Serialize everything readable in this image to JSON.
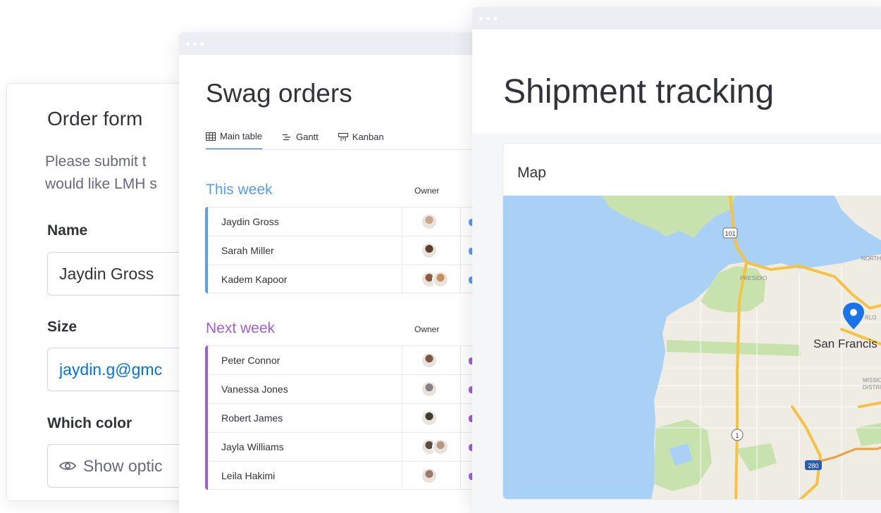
{
  "order_form": {
    "title": "Order form",
    "description": "Please submit t\nwould like LMH s",
    "name_label": "Name",
    "name_value": "Jaydin Gross",
    "size_label": "Size",
    "size_value": "jaydin.g@gmc",
    "color_label": "Which color",
    "color_button": "Show optic",
    "icons": {
      "show_options": "eye-icon"
    }
  },
  "swag": {
    "title": "Swag orders",
    "tabs": [
      {
        "label": "Main table",
        "icon": "table-icon",
        "active": true
      },
      {
        "label": "Gantt",
        "icon": "gantt-icon",
        "active": false
      },
      {
        "label": "Kanban",
        "icon": "kanban-icon",
        "active": false
      }
    ],
    "groups": [
      {
        "title": "This week",
        "owner_header": "Owner",
        "color": "#579bfc",
        "rows": [
          {
            "name": "Jaydin Gross",
            "avatars": [
              "#c9a88a"
            ]
          },
          {
            "name": "Sarah Miller",
            "avatars": [
              "#5a3e2b"
            ]
          },
          {
            "name": "Kadem Kapoor",
            "avatars": [
              "#8c5a3c",
              "#c98d5e"
            ]
          }
        ]
      },
      {
        "title": "Next week",
        "owner_header": "Owner",
        "color": "#a25ddc",
        "rows": [
          {
            "name": "Peter Connor",
            "avatars": [
              "#7a5640"
            ]
          },
          {
            "name": "Vanessa Jones",
            "avatars": [
              "#8a7d86"
            ]
          },
          {
            "name": "Robert James",
            "avatars": [
              "#3e3a36"
            ]
          },
          {
            "name": "Jayla Williams",
            "avatars": [
              "#5e4a3c",
              "#b59782"
            ]
          },
          {
            "name": "Leila Hakimi",
            "avatars": [
              "#9a7a68"
            ]
          }
        ]
      }
    ]
  },
  "shipment": {
    "title": "Shipment tracking",
    "map_label": "Map",
    "map": {
      "city_label": "San Francis",
      "district_presidio": "PRESIDIO",
      "district_north": "NORTH B",
      "district_mission": "MISSION\nDISTRICT",
      "district_partial": "RLO",
      "route_101": "101",
      "route_1": "1",
      "route_280": "280",
      "water_color": "#a8d1f5",
      "land_color": "#efece4",
      "park_color": "#c8e2ae",
      "highway_color": "#f6c244",
      "pin_color": "#1a73e8",
      "pin_icon": "map-pin-icon"
    }
  }
}
